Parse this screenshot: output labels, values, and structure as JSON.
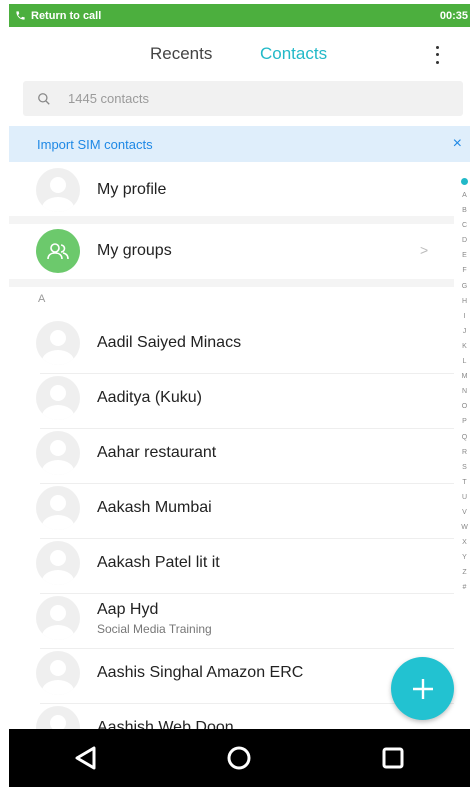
{
  "status_bar": {
    "call_label": "Return to call",
    "time": "00:35",
    "accent": "#4caf3e"
  },
  "tabs": {
    "recents": "Recents",
    "contacts": "Contacts",
    "active_color": "#22b9c8"
  },
  "search": {
    "placeholder": "1445 contacts"
  },
  "banner": {
    "label": "Import SIM contacts",
    "close": "×"
  },
  "profile": {
    "label": "My profile"
  },
  "groups": {
    "label": "My groups",
    "chevron": ">"
  },
  "section_header": "A",
  "contacts": [
    {
      "name": "Aadil Saiyed Minacs"
    },
    {
      "name": "Aaditya (Kuku)"
    },
    {
      "name": "Aahar restaurant"
    },
    {
      "name": "Aakash Mumbai"
    },
    {
      "name": "Aakash Patel lit it"
    },
    {
      "name": "Aap Hyd",
      "subtitle": "Social Media Training"
    },
    {
      "name": "Aashis Singhal Amazon ERC"
    },
    {
      "name": "Aashish Web Doon"
    }
  ],
  "index_letters": [
    "A",
    "B",
    "C",
    "D",
    "E",
    "F",
    "G",
    "H",
    "I",
    "J",
    "K",
    "L",
    "M",
    "N",
    "O",
    "P",
    "Q",
    "R",
    "S",
    "T",
    "U",
    "V",
    "W",
    "X",
    "Y",
    "Z",
    "#"
  ],
  "fab": {
    "icon": "plus-icon",
    "color": "#22c2d1"
  },
  "nav": {
    "back": "back-icon",
    "home": "home-icon",
    "recents": "recents-icon"
  }
}
